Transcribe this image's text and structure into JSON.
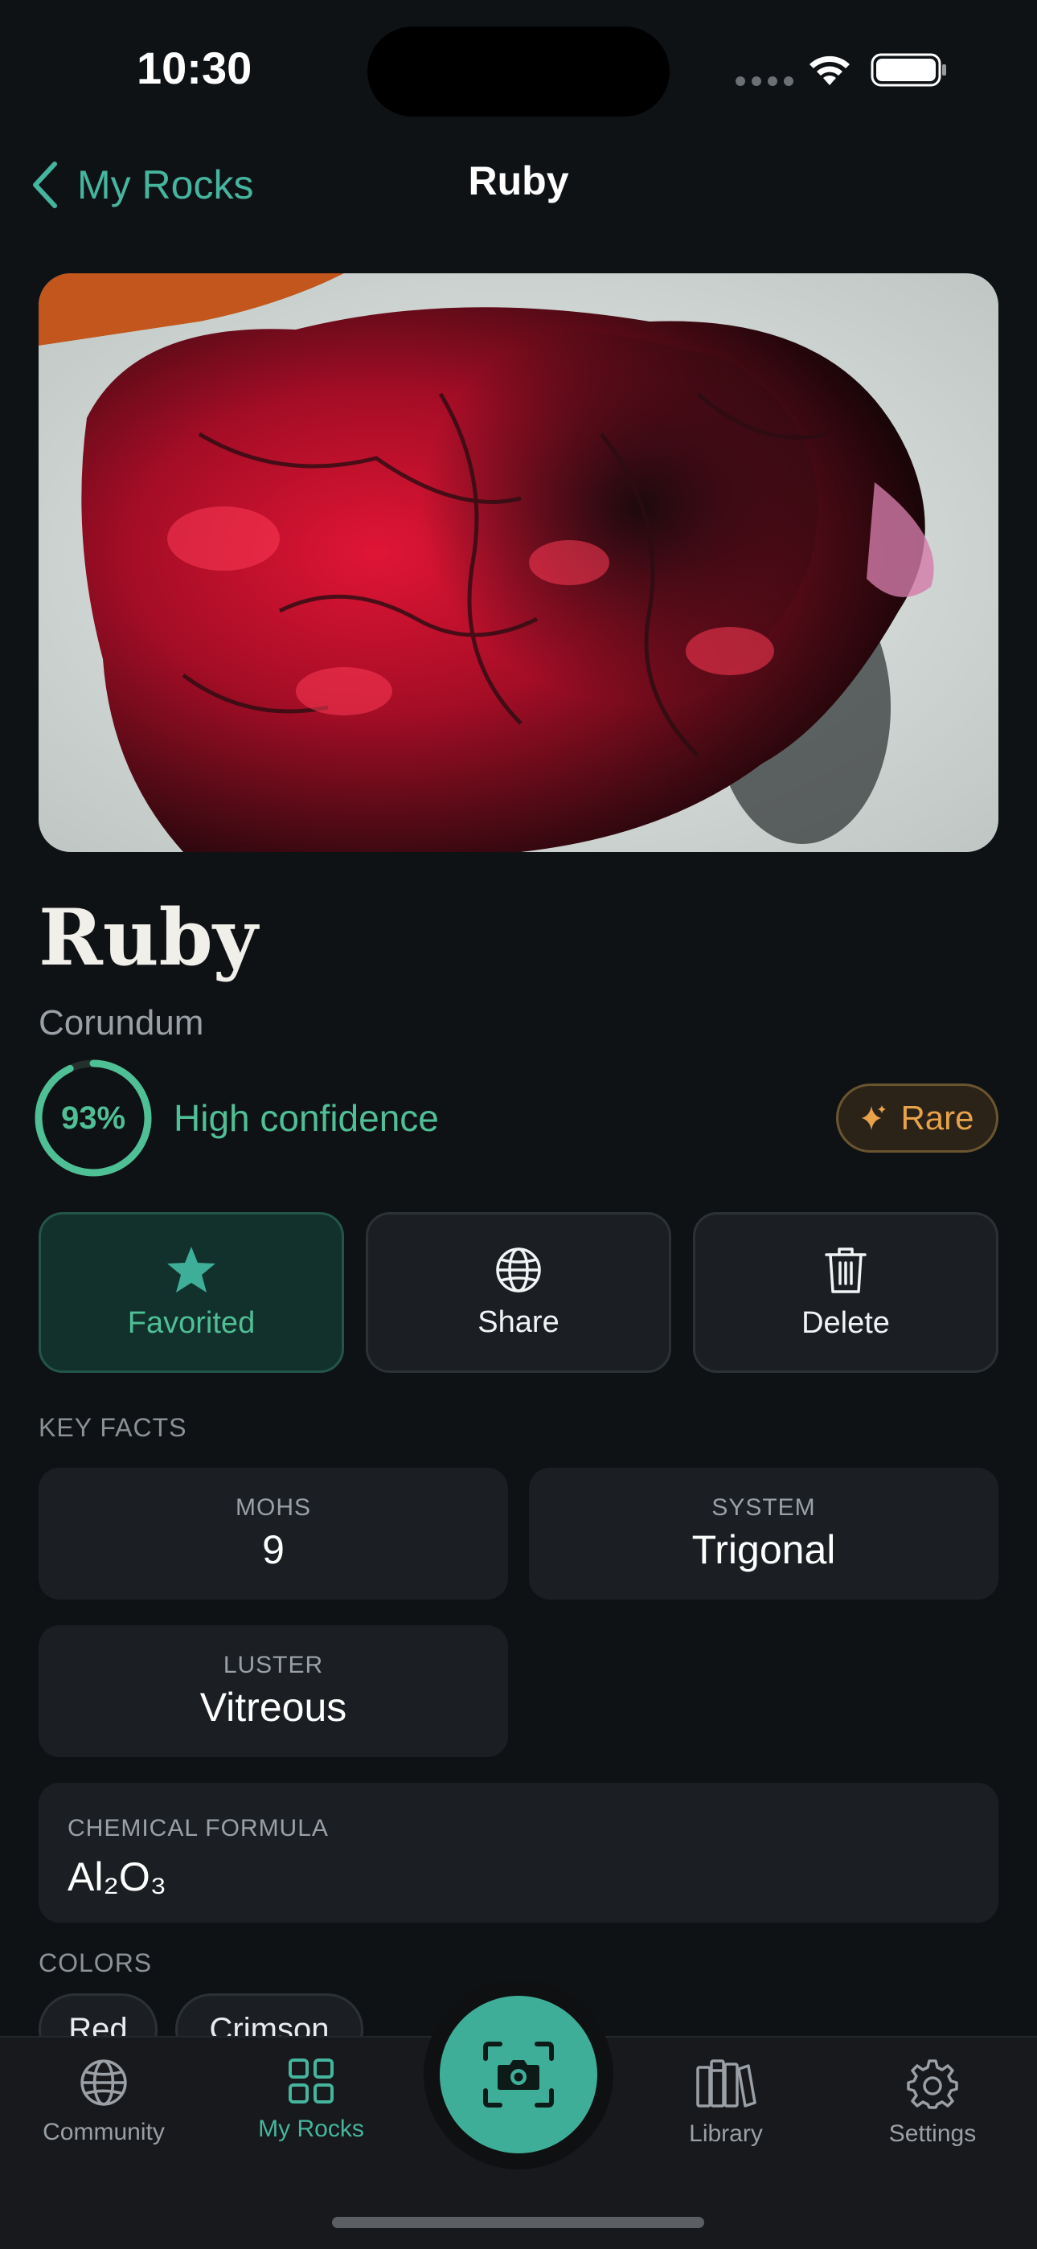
{
  "status_bar": {
    "time": "10:30"
  },
  "nav": {
    "back_label": "My Rocks",
    "title": "Ruby"
  },
  "rock": {
    "name": "Ruby",
    "species": "Corundum",
    "confidence_percent": 93,
    "confidence_text": "93%",
    "confidence_label": "High confidence",
    "rarity_badge": "Rare"
  },
  "actions": {
    "favorite_label": "Favorited",
    "share_label": "Share",
    "delete_label": "Delete"
  },
  "key_facts": {
    "heading": "KEY FACTS",
    "mohs_label": "MOHS",
    "mohs_value": "9",
    "system_label": "SYSTEM",
    "system_value": "Trigonal",
    "luster_label": "LUSTER",
    "luster_value": "Vitreous",
    "formula_label": "CHEMICAL FORMULA",
    "formula_value": "Al₂O₃"
  },
  "colors": {
    "heading": "COLORS",
    "items": [
      "Red",
      "Crimson"
    ]
  },
  "tab_bar": {
    "community": "Community",
    "my_rocks": "My Rocks",
    "library": "Library",
    "settings": "Settings"
  },
  "theme": {
    "accent": "#45b59e",
    "confidence_green": "#4fbf95",
    "rare_orange": "#e8a24a",
    "background": "#0f1215"
  },
  "icons": [
    "chevron-left-icon",
    "wifi-icon",
    "battery-icon",
    "sparkle-icon",
    "star-icon",
    "globe-icon",
    "trash-icon",
    "camera-icon",
    "grid-icon",
    "books-icon",
    "gear-icon"
  ]
}
